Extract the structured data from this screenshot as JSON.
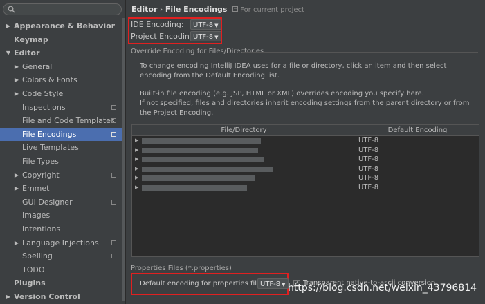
{
  "sidebar": {
    "search_placeholder": "",
    "items": [
      {
        "label": "Appearance & Behavior",
        "arrow": "▶",
        "bold": true,
        "indent": 0,
        "project": false,
        "selected": false
      },
      {
        "label": "Keymap",
        "arrow": "",
        "bold": true,
        "indent": 0,
        "project": false,
        "selected": false
      },
      {
        "label": "Editor",
        "arrow": "▼",
        "bold": true,
        "indent": 0,
        "project": false,
        "selected": false
      },
      {
        "label": "General",
        "arrow": "▶",
        "bold": false,
        "indent": 1,
        "project": false,
        "selected": false
      },
      {
        "label": "Colors & Fonts",
        "arrow": "▶",
        "bold": false,
        "indent": 1,
        "project": false,
        "selected": false
      },
      {
        "label": "Code Style",
        "arrow": "▶",
        "bold": false,
        "indent": 1,
        "project": false,
        "selected": false
      },
      {
        "label": "Inspections",
        "arrow": "",
        "bold": false,
        "indent": 1,
        "project": true,
        "selected": false
      },
      {
        "label": "File and Code Templates",
        "arrow": "",
        "bold": false,
        "indent": 1,
        "project": true,
        "selected": false
      },
      {
        "label": "File Encodings",
        "arrow": "",
        "bold": false,
        "indent": 1,
        "project": true,
        "selected": true
      },
      {
        "label": "Live Templates",
        "arrow": "",
        "bold": false,
        "indent": 1,
        "project": false,
        "selected": false
      },
      {
        "label": "File Types",
        "arrow": "",
        "bold": false,
        "indent": 1,
        "project": false,
        "selected": false
      },
      {
        "label": "Copyright",
        "arrow": "▶",
        "bold": false,
        "indent": 1,
        "project": true,
        "selected": false
      },
      {
        "label": "Emmet",
        "arrow": "▶",
        "bold": false,
        "indent": 1,
        "project": false,
        "selected": false
      },
      {
        "label": "GUI Designer",
        "arrow": "",
        "bold": false,
        "indent": 1,
        "project": true,
        "selected": false
      },
      {
        "label": "Images",
        "arrow": "",
        "bold": false,
        "indent": 1,
        "project": false,
        "selected": false
      },
      {
        "label": "Intentions",
        "arrow": "",
        "bold": false,
        "indent": 1,
        "project": false,
        "selected": false
      },
      {
        "label": "Language Injections",
        "arrow": "▶",
        "bold": false,
        "indent": 1,
        "project": true,
        "selected": false
      },
      {
        "label": "Spelling",
        "arrow": "",
        "bold": false,
        "indent": 1,
        "project": true,
        "selected": false
      },
      {
        "label": "TODO",
        "arrow": "",
        "bold": false,
        "indent": 1,
        "project": false,
        "selected": false
      },
      {
        "label": "Plugins",
        "arrow": "",
        "bold": true,
        "indent": 0,
        "project": false,
        "selected": false
      },
      {
        "label": "Version Control",
        "arrow": "▶",
        "bold": true,
        "indent": 0,
        "project": false,
        "selected": false
      }
    ]
  },
  "breadcrumb": {
    "parent": "Editor",
    "separator": "›",
    "current": "File Encodings",
    "note": "For current project"
  },
  "ide_encoding": {
    "label": "IDE Encoding:",
    "value": "UTF-8"
  },
  "project_encoding": {
    "label": "Project Encoding:",
    "value": "UTF-8"
  },
  "override": {
    "title": "Override Encoding for Files/Directories",
    "desc1": "To change encoding IntelliJ IDEA uses for a file or directory, click an item and then select encoding from the Default Encoding list.",
    "desc2": "Built-in file encoding (e.g. JSP, HTML or XML) overrides encoding you specify here.",
    "desc3": "If not specified, files and directories inherit encoding settings from the parent directory or from the Project Encoding."
  },
  "table": {
    "headers": [
      "File/Directory",
      "Default Encoding"
    ],
    "rows": [
      {
        "encoding": "UTF-8"
      },
      {
        "encoding": "UTF-8"
      },
      {
        "encoding": "UTF-8"
      },
      {
        "encoding": "UTF-8"
      },
      {
        "encoding": "UTF-8"
      },
      {
        "encoding": "UTF-8"
      }
    ]
  },
  "properties": {
    "title": "Properties Files (*.properties)",
    "label": "Default encoding for properties files:",
    "value": "UTF-8",
    "transparent_label": "Transparent native-to-ascii conversion",
    "transparent_checked": true
  },
  "watermark": "https://blog.csdn.net/weixin_43796814",
  "colors": {
    "selection": "#4b6eaf",
    "highlight_box": "#e02020",
    "background": "#3c3f41"
  }
}
